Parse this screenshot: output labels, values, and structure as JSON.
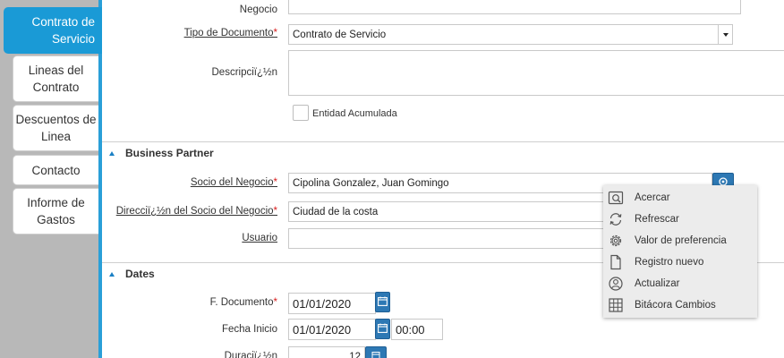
{
  "tabs": [
    {
      "label": "Contrato de Servicio",
      "active": true
    },
    {
      "label": "Lineas del Contrato"
    },
    {
      "label": "Descuentos de Linea"
    },
    {
      "label": "Contacto"
    },
    {
      "label": "Informe de Gastos"
    }
  ],
  "form": {
    "negocio_label": "Negocio",
    "tipo_documento_label": "Tipo de Documento",
    "tipo_documento_value": "Contrato de Servicio",
    "descripcion_label": "Descripciï¿½n",
    "entidad_acumulada_label": "Entidad Acumulada",
    "required_mark": "*"
  },
  "sections": {
    "business_partner": {
      "title": "Business Partner",
      "socio_label": "Socio del Negocio",
      "socio_value": "Cipolina Gonzalez, Juan Gomingo",
      "direccion_label": "Direcciï¿½n del Socio del Negocio",
      "direccion_value": "Ciudad de la costa",
      "usuario_label": "Usuario",
      "usuario_value": ""
    },
    "dates": {
      "title": "Dates",
      "f_documento_label": "F. Documento",
      "f_documento_value": "01/01/2020",
      "fecha_inicio_label": "Fecha Inicio",
      "fecha_inicio_value": "01/01/2020",
      "hora_inicio_value": "00:00",
      "duracion_label": "Duraciï¿½n",
      "duracion_value": "12"
    }
  },
  "context_menu": {
    "items": [
      {
        "label": "Acercar",
        "icon": "zoom-icon"
      },
      {
        "label": "Refrescar",
        "icon": "refresh-icon"
      },
      {
        "label": "Valor de preferencia",
        "icon": "gear-icon"
      },
      {
        "label": "Registro nuevo",
        "icon": "new-document-icon"
      },
      {
        "label": "Actualizar",
        "icon": "user-icon"
      },
      {
        "label": "Bitácora Cambios",
        "icon": "grid-icon"
      }
    ]
  },
  "colors": {
    "accent": "#1a9ad6",
    "required": "#d81e1e",
    "button": "#2d78b4"
  }
}
